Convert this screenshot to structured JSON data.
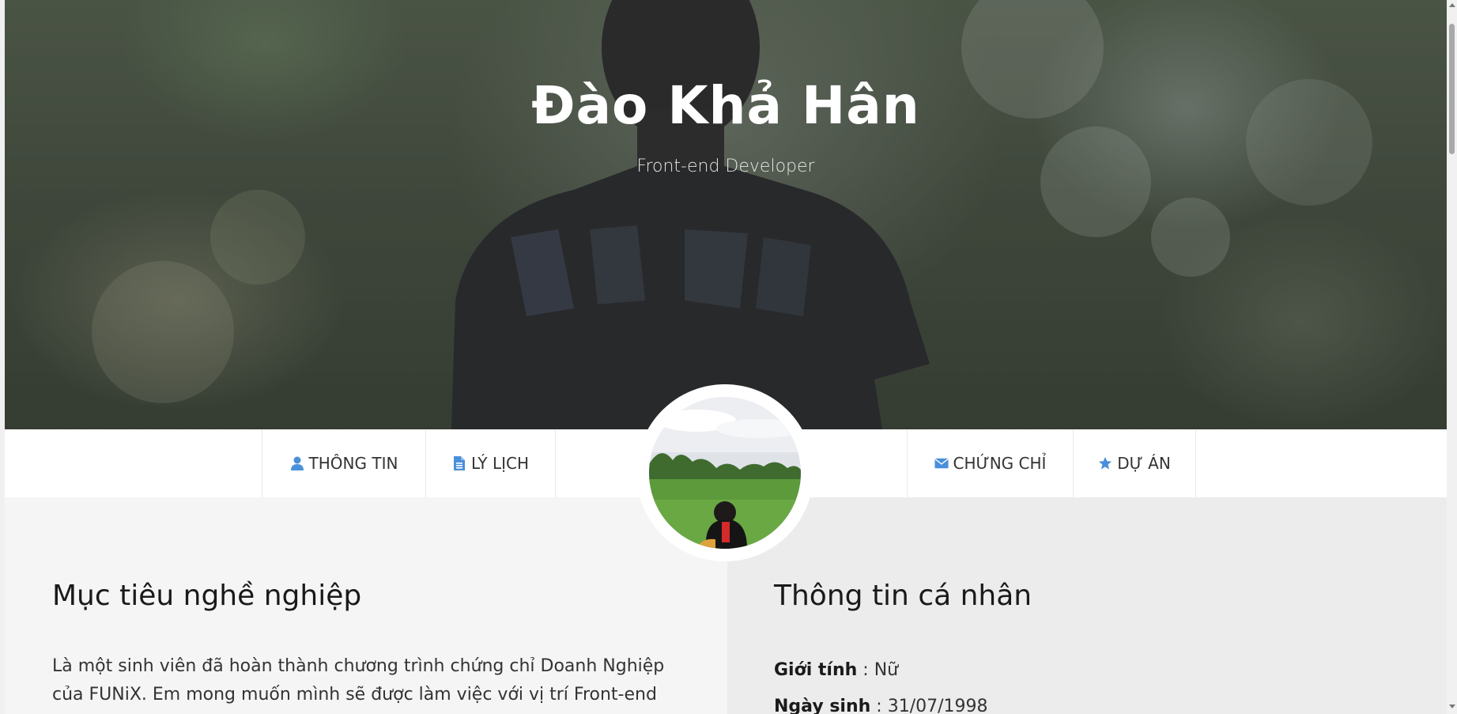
{
  "hero": {
    "name": "Đào Khả Hân",
    "role": "Front-end Developer"
  },
  "nav": {
    "items": [
      {
        "label": "THÔNG TIN",
        "icon": "user-icon"
      },
      {
        "label": "LÝ LỊCH",
        "icon": "document-icon"
      },
      {
        "label": "CHỨNG CHỈ",
        "icon": "envelope-icon"
      },
      {
        "label": "DỰ ÁN",
        "icon": "star-icon"
      }
    ],
    "icon_color": "#4a90d9"
  },
  "objective": {
    "title": "Mục tiêu nghề nghiệp",
    "text": "Là một sinh viên đã hoàn thành chương trình chứng chỉ Doanh Nghiệp của FUNiX. Em mong muốn mình sẽ được làm việc với vị trí Front-end"
  },
  "personal": {
    "title": "Thông tin cá nhân",
    "rows": [
      {
        "label": "Giới tính",
        "sep": " : ",
        "value": "Nữ"
      },
      {
        "label": "Ngày sinh",
        "sep": " : ",
        "value": "31/07/1998"
      }
    ]
  }
}
